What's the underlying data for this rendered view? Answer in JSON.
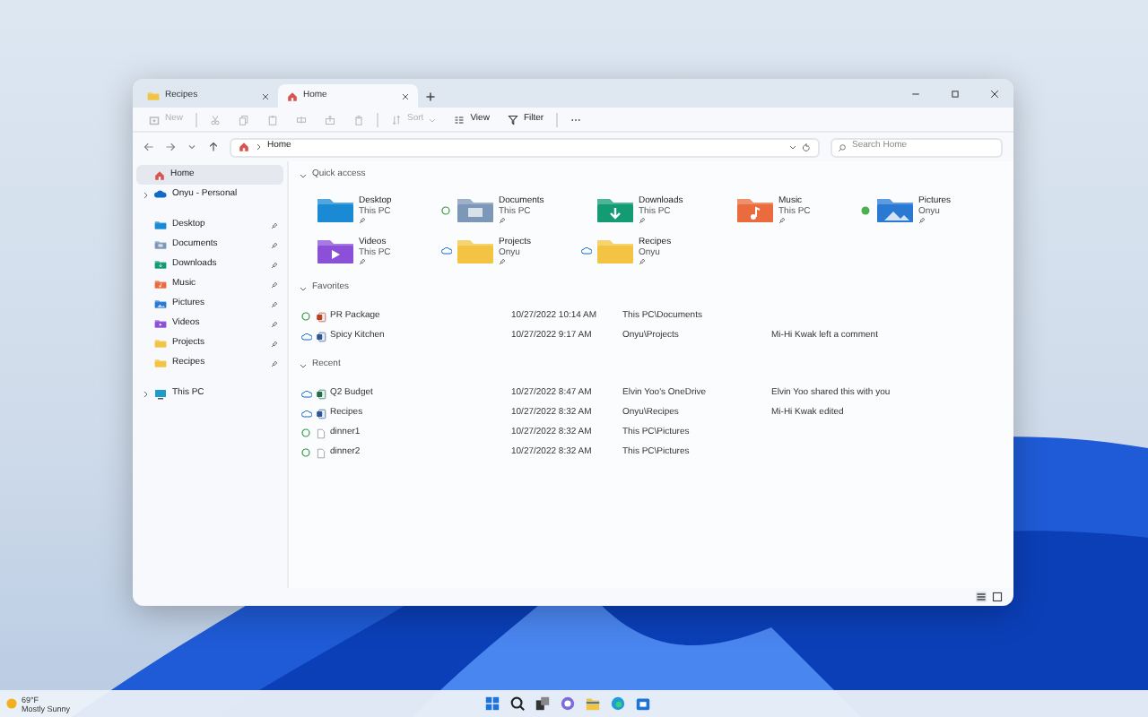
{
  "window": {
    "tabs": [
      {
        "label": "Recipes",
        "kind": "folder",
        "selected": false
      },
      {
        "label": "Home",
        "kind": "home",
        "selected": true
      }
    ]
  },
  "toolbar": [
    {
      "kind": "new",
      "label": "New",
      "disabled": true
    },
    {
      "kind": "cut",
      "disabled": true
    },
    {
      "kind": "copy",
      "disabled": true
    },
    {
      "kind": "paste",
      "disabled": true
    },
    {
      "kind": "rename",
      "disabled": true
    },
    {
      "kind": "share",
      "disabled": true
    },
    {
      "kind": "delete",
      "disabled": true
    },
    {
      "kind": "sort",
      "label": "Sort",
      "disabled": true
    },
    {
      "kind": "view",
      "label": "View",
      "disabled": false
    },
    {
      "kind": "filter",
      "label": "Filter",
      "disabled": false
    },
    {
      "kind": "more",
      "disabled": false
    }
  ],
  "address": {
    "path": [
      "Home"
    ],
    "search": {
      "placeholder": "Search Home"
    }
  },
  "sidebar": {
    "top": [
      {
        "label": "Home",
        "kind": "home",
        "selected": true
      },
      {
        "label": "Onyu - Personal",
        "kind": "cloud",
        "expanded": false,
        "selected": false
      }
    ],
    "pinned": [
      {
        "label": "Desktop",
        "kind": "desktop",
        "pinned": true,
        "selected": false
      },
      {
        "label": "Documents",
        "kind": "documents",
        "pinned": true,
        "selected": false
      },
      {
        "label": "Downloads",
        "kind": "downloads",
        "pinned": true,
        "selected": false
      },
      {
        "label": "Music",
        "kind": "music",
        "pinned": true,
        "selected": false
      },
      {
        "label": "Pictures",
        "kind": "pictures",
        "pinned": true,
        "selected": false
      },
      {
        "label": "Videos",
        "kind": "videos",
        "pinned": true,
        "selected": false
      },
      {
        "label": "Projects",
        "kind": "folder",
        "pinned": true,
        "selected": false
      },
      {
        "label": "Recipes",
        "kind": "folder",
        "pinned": true,
        "selected": false
      }
    ],
    "bottom": [
      {
        "label": "This PC",
        "kind": "pc",
        "expanded": false,
        "selected": false
      }
    ]
  },
  "quick_access": {
    "title": "Quick access",
    "expanded": true,
    "items": [
      {
        "name": "Desktop",
        "location": "This PC",
        "kind": "desktop",
        "pinned": true
      },
      {
        "name": "Documents",
        "location": "This PC",
        "kind": "documents",
        "status": {
          "kind": "synced"
        },
        "pinned": true
      },
      {
        "name": "Downloads",
        "location": "This PC",
        "kind": "downloads",
        "pinned": true
      },
      {
        "name": "Music",
        "location": "This PC",
        "kind": "music",
        "pinned": true
      },
      {
        "name": "Pictures",
        "location": "Onyu",
        "kind": "pictures",
        "status": {
          "kind": "available"
        },
        "pinned": true
      },
      {
        "name": "Videos",
        "location": "This PC",
        "kind": "videos",
        "pinned": true
      },
      {
        "name": "Projects",
        "location": "Onyu",
        "kind": "folder",
        "status": {
          "kind": "cloud"
        },
        "pinned": true
      },
      {
        "name": "Recipes",
        "location": "Onyu",
        "kind": "folder",
        "status": {
          "kind": "cloud"
        },
        "pinned": true
      }
    ]
  },
  "favorites": {
    "title": "Favorites",
    "expanded": true,
    "rows": [
      {
        "name": "PR Package",
        "kind": "powerpoint",
        "status": {
          "kind": "synced"
        },
        "date": "10/27/2022 10:14 AM",
        "location": "This PC\\Documents"
      },
      {
        "name": "Spicy Kitchen",
        "kind": "word",
        "status": {
          "kind": "cloud"
        },
        "date": "10/27/2022 9:17 AM",
        "location": "Onyu\\Projects",
        "activity": "Mi-Hi Kwak left a comment"
      }
    ]
  },
  "recent": {
    "title": "Recent",
    "expanded": true,
    "rows": [
      {
        "name": "Q2 Budget",
        "kind": "excel",
        "status": {
          "kind": "cloud"
        },
        "date": "10/27/2022 8:47 AM",
        "location": "Elvin Yoo's OneDrive",
        "activity": "Elvin Yoo shared this with you"
      },
      {
        "name": "Recipes",
        "kind": "word",
        "status": {
          "kind": "cloud"
        },
        "date": "10/27/2022 8:32 AM",
        "location": "Onyu\\Recipes",
        "activity": "Mi-Hi Kwak edited"
      },
      {
        "name": "dinner1",
        "kind": "image",
        "status": {
          "kind": "synced"
        },
        "date": "10/27/2022 8:32 AM",
        "location": "This PC\\Pictures"
      },
      {
        "name": "dinner2",
        "kind": "image",
        "status": {
          "kind": "synced"
        },
        "date": "10/27/2022 8:32 AM",
        "location": "This PC\\Pictures"
      }
    ]
  },
  "status_bar": {
    "views": [
      {
        "kind": "details",
        "selected": true
      },
      {
        "kind": "tiles",
        "selected": false
      }
    ]
  },
  "taskbar": {
    "weather": {
      "temperature": "69°F",
      "condition": "Mostly Sunny"
    },
    "apps": [
      {
        "kind": "start"
      },
      {
        "kind": "search"
      },
      {
        "kind": "taskview"
      },
      {
        "kind": "chat"
      },
      {
        "kind": "explorer"
      },
      {
        "kind": "edge"
      },
      {
        "kind": "store"
      }
    ]
  }
}
